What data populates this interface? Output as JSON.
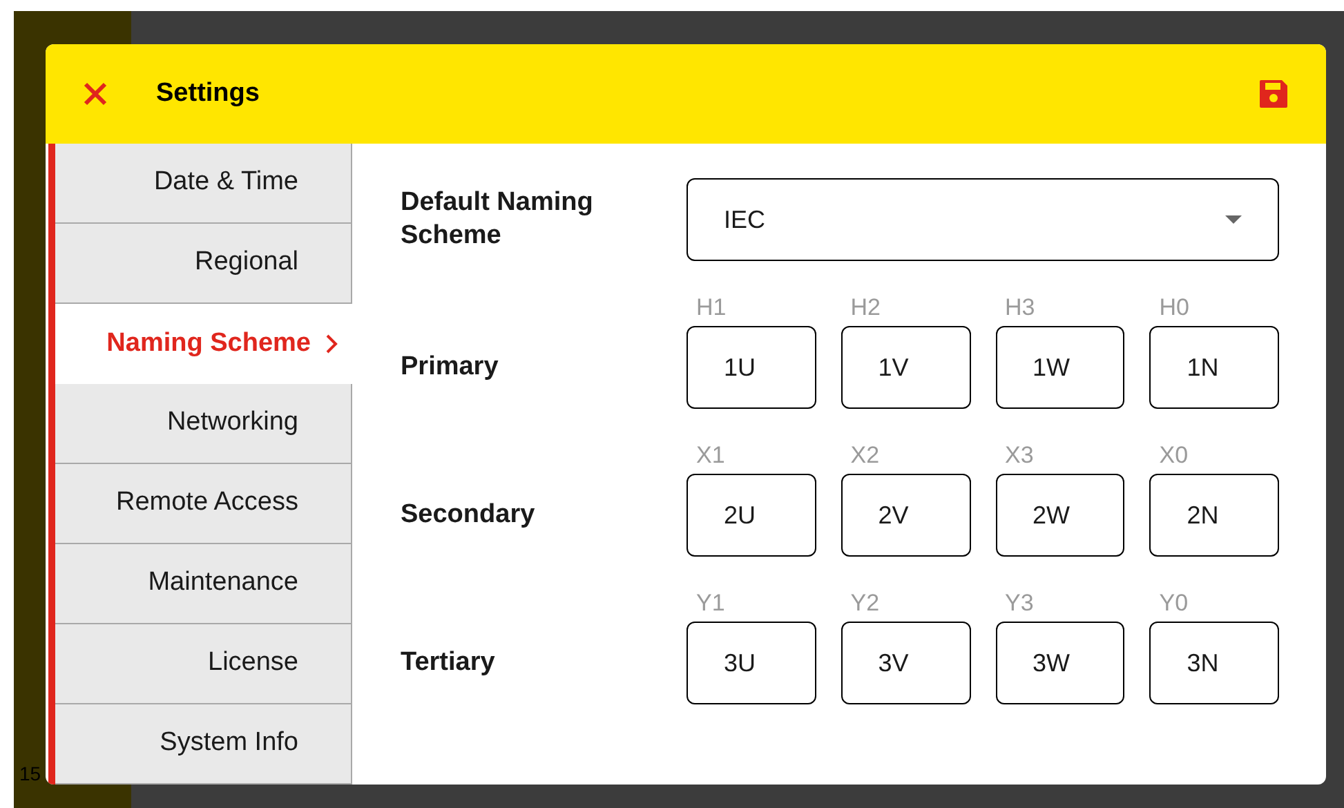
{
  "background": {
    "partial_text": "15"
  },
  "dialog": {
    "title": "Settings"
  },
  "sidebar": {
    "items": [
      {
        "label": "Date & Time",
        "selected": false
      },
      {
        "label": "Regional",
        "selected": false
      },
      {
        "label": "Naming Scheme",
        "selected": true
      },
      {
        "label": "Networking",
        "selected": false
      },
      {
        "label": "Remote Access",
        "selected": false
      },
      {
        "label": "Maintenance",
        "selected": false
      },
      {
        "label": "License",
        "selected": false
      },
      {
        "label": "System Info",
        "selected": false
      }
    ]
  },
  "default_scheme": {
    "label": "Default Naming Scheme",
    "value": "IEC"
  },
  "rows": [
    {
      "label": "Primary",
      "fields": [
        {
          "caption": "H1",
          "value": "1U"
        },
        {
          "caption": "H2",
          "value": "1V"
        },
        {
          "caption": "H3",
          "value": "1W"
        },
        {
          "caption": "H0",
          "value": "1N"
        }
      ]
    },
    {
      "label": "Secondary",
      "fields": [
        {
          "caption": "X1",
          "value": "2U"
        },
        {
          "caption": "X2",
          "value": "2V"
        },
        {
          "caption": "X3",
          "value": "2W"
        },
        {
          "caption": "X0",
          "value": "2N"
        }
      ]
    },
    {
      "label": "Tertiary",
      "fields": [
        {
          "caption": "Y1",
          "value": "3U"
        },
        {
          "caption": "Y2",
          "value": "3V"
        },
        {
          "caption": "Y3",
          "value": "3W"
        },
        {
          "caption": "Y0",
          "value": "3N"
        }
      ]
    }
  ]
}
